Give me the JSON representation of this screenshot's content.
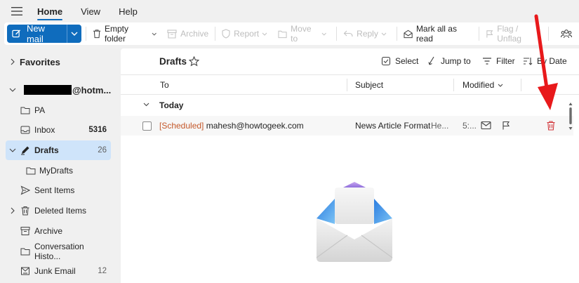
{
  "ribbon": {
    "tabs": [
      {
        "label": "Home",
        "active": true
      },
      {
        "label": "View",
        "active": false
      },
      {
        "label": "Help",
        "active": false
      }
    ]
  },
  "toolbar": {
    "new_mail": "New mail",
    "empty_folder": "Empty folder",
    "archive": "Archive",
    "report": "Report",
    "move_to": "Move to",
    "reply": "Reply",
    "mark_all_read": "Mark all as read",
    "flag_unflag": "Flag / Unflag"
  },
  "sidebar": {
    "favorites": "Favorites",
    "account_suffix": "@hotm...",
    "items": [
      {
        "label": "PA",
        "count": "",
        "icon": "folder-icon"
      },
      {
        "label": "Inbox",
        "count": "5316",
        "icon": "inbox-icon"
      },
      {
        "label": "Drafts",
        "count": "26",
        "icon": "pencil-icon"
      },
      {
        "label": "MyDrafts",
        "count": "",
        "icon": "folder-icon"
      },
      {
        "label": "Sent Items",
        "count": "",
        "icon": "send-icon"
      },
      {
        "label": "Deleted Items",
        "count": "",
        "icon": "trash-icon"
      },
      {
        "label": "Archive",
        "count": "",
        "icon": "archive-icon"
      },
      {
        "label": "Conversation Histo...",
        "count": "",
        "icon": "folder-icon"
      },
      {
        "label": "Junk Email",
        "count": "12",
        "icon": "junk-icon"
      }
    ]
  },
  "main": {
    "folder_title": "Drafts",
    "tools": {
      "select": "Select",
      "jump_to": "Jump to",
      "filter": "Filter",
      "sort": "By Date"
    },
    "columns": {
      "to": "To",
      "subject": "Subject",
      "modified": "Modified"
    },
    "group": "Today",
    "messages": [
      {
        "scheduled_tag": "[Scheduled]",
        "to": "mahesh@howtogeek.com",
        "subject": "News Article Format",
        "preview": "He...",
        "modified": "5:..."
      }
    ]
  },
  "colors": {
    "accent": "#0f6cbd",
    "selected_nav": "#cfe4fa",
    "scheduled": "#c4582a",
    "delete_red": "#d13438",
    "annotation_arrow": "#e8191b"
  }
}
